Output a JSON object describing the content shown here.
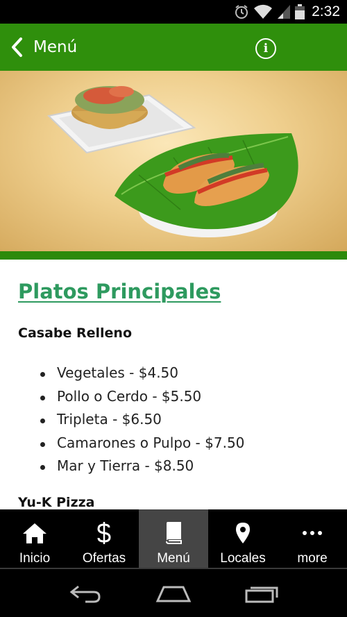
{
  "status_bar": {
    "time": "2:32",
    "icons": [
      "alarm-icon",
      "wifi-icon",
      "signal-icon",
      "battery-icon"
    ]
  },
  "action_bar": {
    "title": "Menú",
    "back_icon": "chevron-left-icon",
    "info_icon": "info-icon",
    "color": "#2f8f0c"
  },
  "hero": {
    "image": "food-photo-casabe-and-tamales"
  },
  "content": {
    "section_title": "Platos Principales",
    "items": [
      {
        "title": "Casabe Relleno",
        "prices": [
          "Vegetales - $4.50",
          "Pollo o Cerdo - $5.50",
          "Tripleta - $6.50",
          "Camarones o Pulpo - $7.50",
          "Mar y Tierra - $8.50"
        ]
      },
      {
        "title": "Yu-K Pizza"
      }
    ],
    "title_color": "#2e9a5f"
  },
  "tabs": [
    {
      "label": "Inicio",
      "icon": "home-icon",
      "active": false
    },
    {
      "label": "Ofertas",
      "icon": "dollar-icon",
      "active": false
    },
    {
      "label": "Menú",
      "icon": "book-icon",
      "active": true
    },
    {
      "label": "Locales",
      "icon": "location-pin-icon",
      "active": false
    },
    {
      "label": "more",
      "icon": "more-dots-icon",
      "active": false
    }
  ],
  "nav_bar": {
    "buttons": [
      "back-nav-icon",
      "home-nav-icon",
      "recents-nav-icon"
    ]
  }
}
